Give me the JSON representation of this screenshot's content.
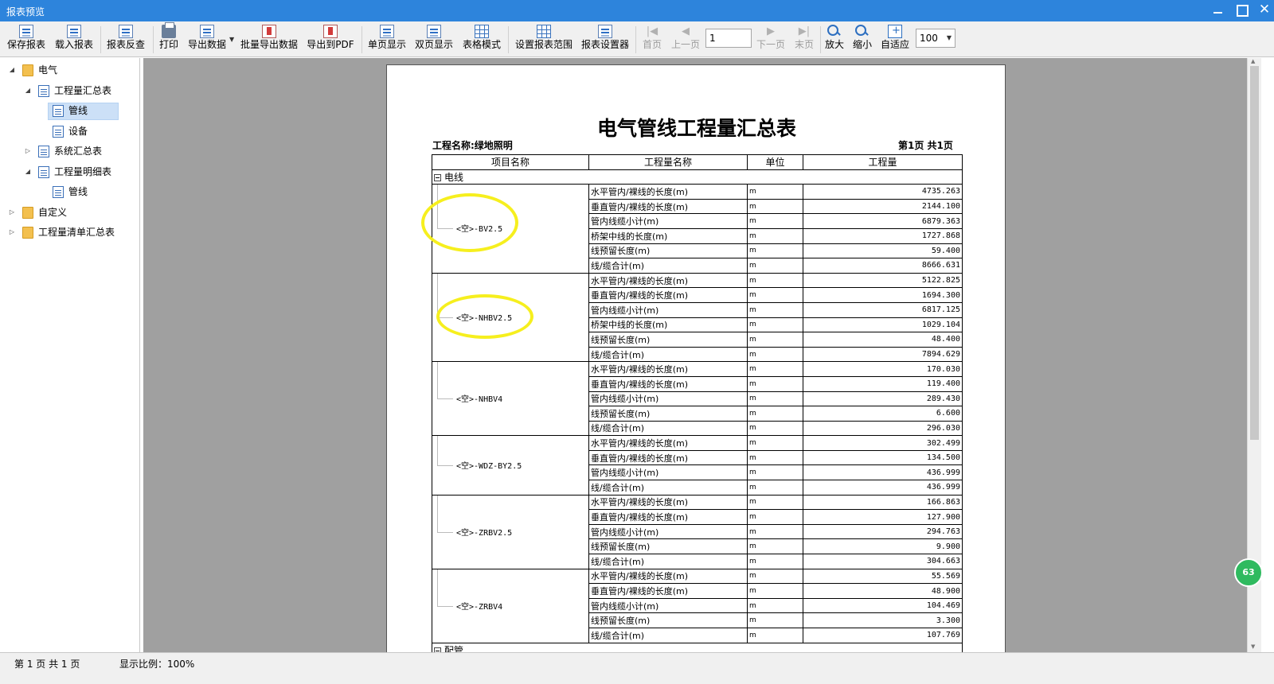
{
  "window": {
    "title": "报表预览"
  },
  "toolbar": {
    "save_report": "保存报表",
    "load_report": "载入报表",
    "report_lookup": "报表反查",
    "print": "打印",
    "export_data": "导出数据",
    "batch_export": "批量导出数据",
    "export_pdf": "导出到PDF",
    "single_page": "单页显示",
    "double_page": "双页显示",
    "table_mode": "表格模式",
    "set_range": "设置报表范围",
    "report_designer": "报表设置器",
    "first_page": "首页",
    "prev_page": "上一页",
    "page_value": "1",
    "next_page": "下一页",
    "last_page": "末页",
    "zoom_in": "放大",
    "zoom_out": "缩小",
    "fit": "自适应",
    "zoom_value": "100"
  },
  "tree": {
    "n0": "电气",
    "n1": "工程量汇总表",
    "n2": "管线",
    "n3": "设备",
    "n4": "系统汇总表",
    "n5": "工程量明细表",
    "n6": "管线",
    "n7": "自定义",
    "n8": "工程量清单汇总表"
  },
  "report": {
    "title": "电气管线工程量汇总表",
    "project_label": "工程名称:绿地照明",
    "page_of": "第1页 共1页",
    "headers": {
      "item": "项目名称",
      "qty_name": "工程量名称",
      "unit": "单位",
      "qty": "工程量"
    },
    "group1": "电线",
    "group2": "配管",
    "items": [
      {
        "name": "<空>-BV2.5",
        "rows": [
          {
            "label": "水平管内/裸线的长度(m)",
            "unit": "m",
            "value": "4735.263"
          },
          {
            "label": "垂直管内/裸线的长度(m)",
            "unit": "m",
            "value": "2144.100"
          },
          {
            "label": "管内线缆小计(m)",
            "unit": "m",
            "value": "6879.363"
          },
          {
            "label": "桥架中线的长度(m)",
            "unit": "m",
            "value": "1727.868"
          },
          {
            "label": "线预留长度(m)",
            "unit": "m",
            "value": "59.400"
          },
          {
            "label": "线/缆合计(m)",
            "unit": "m",
            "value": "8666.631"
          }
        ]
      },
      {
        "name": "<空>-NHBV2.5",
        "rows": [
          {
            "label": "水平管内/裸线的长度(m)",
            "unit": "m",
            "value": "5122.825"
          },
          {
            "label": "垂直管内/裸线的长度(m)",
            "unit": "m",
            "value": "1694.300"
          },
          {
            "label": "管内线缆小计(m)",
            "unit": "m",
            "value": "6817.125"
          },
          {
            "label": "桥架中线的长度(m)",
            "unit": "m",
            "value": "1029.104"
          },
          {
            "label": "线预留长度(m)",
            "unit": "m",
            "value": "48.400"
          },
          {
            "label": "线/缆合计(m)",
            "unit": "m",
            "value": "7894.629"
          }
        ]
      },
      {
        "name": "<空>-NHBV4",
        "rows": [
          {
            "label": "水平管内/裸线的长度(m)",
            "unit": "m",
            "value": "170.030"
          },
          {
            "label": "垂直管内/裸线的长度(m)",
            "unit": "m",
            "value": "119.400"
          },
          {
            "label": "管内线缆小计(m)",
            "unit": "m",
            "value": "289.430"
          },
          {
            "label": "线预留长度(m)",
            "unit": "m",
            "value": "6.600"
          },
          {
            "label": "线/缆合计(m)",
            "unit": "m",
            "value": "296.030"
          }
        ]
      },
      {
        "name": "<空>-WDZ-BY2.5",
        "rows": [
          {
            "label": "水平管内/裸线的长度(m)",
            "unit": "m",
            "value": "302.499"
          },
          {
            "label": "垂直管内/裸线的长度(m)",
            "unit": "m",
            "value": "134.500"
          },
          {
            "label": "管内线缆小计(m)",
            "unit": "m",
            "value": "436.999"
          },
          {
            "label": "线/缆合计(m)",
            "unit": "m",
            "value": "436.999"
          }
        ]
      },
      {
        "name": "<空>-ZRBV2.5",
        "rows": [
          {
            "label": "水平管内/裸线的长度(m)",
            "unit": "m",
            "value": "166.863"
          },
          {
            "label": "垂直管内/裸线的长度(m)",
            "unit": "m",
            "value": "127.900"
          },
          {
            "label": "管内线缆小计(m)",
            "unit": "m",
            "value": "294.763"
          },
          {
            "label": "线预留长度(m)",
            "unit": "m",
            "value": "9.900"
          },
          {
            "label": "线/缆合计(m)",
            "unit": "m",
            "value": "304.663"
          }
        ]
      },
      {
        "name": "<空>-ZRBV4",
        "rows": [
          {
            "label": "水平管内/裸线的长度(m)",
            "unit": "m",
            "value": "55.569"
          },
          {
            "label": "垂直管内/裸线的长度(m)",
            "unit": "m",
            "value": "48.900"
          },
          {
            "label": "管内线缆小计(m)",
            "unit": "m",
            "value": "104.469"
          },
          {
            "label": "线预留长度(m)",
            "unit": "m",
            "value": "3.300"
          },
          {
            "label": "线/缆合计(m)",
            "unit": "m",
            "value": "107.769"
          }
        ]
      }
    ]
  },
  "status": {
    "page_info": "第 1 页  共 1 页",
    "zoom_info": "显示比例：100%"
  },
  "side_badge": "63",
  "colors": {
    "titlebar": "#2d84dc",
    "highlight": "#f6ef1e",
    "selection": "#cce0f7"
  }
}
